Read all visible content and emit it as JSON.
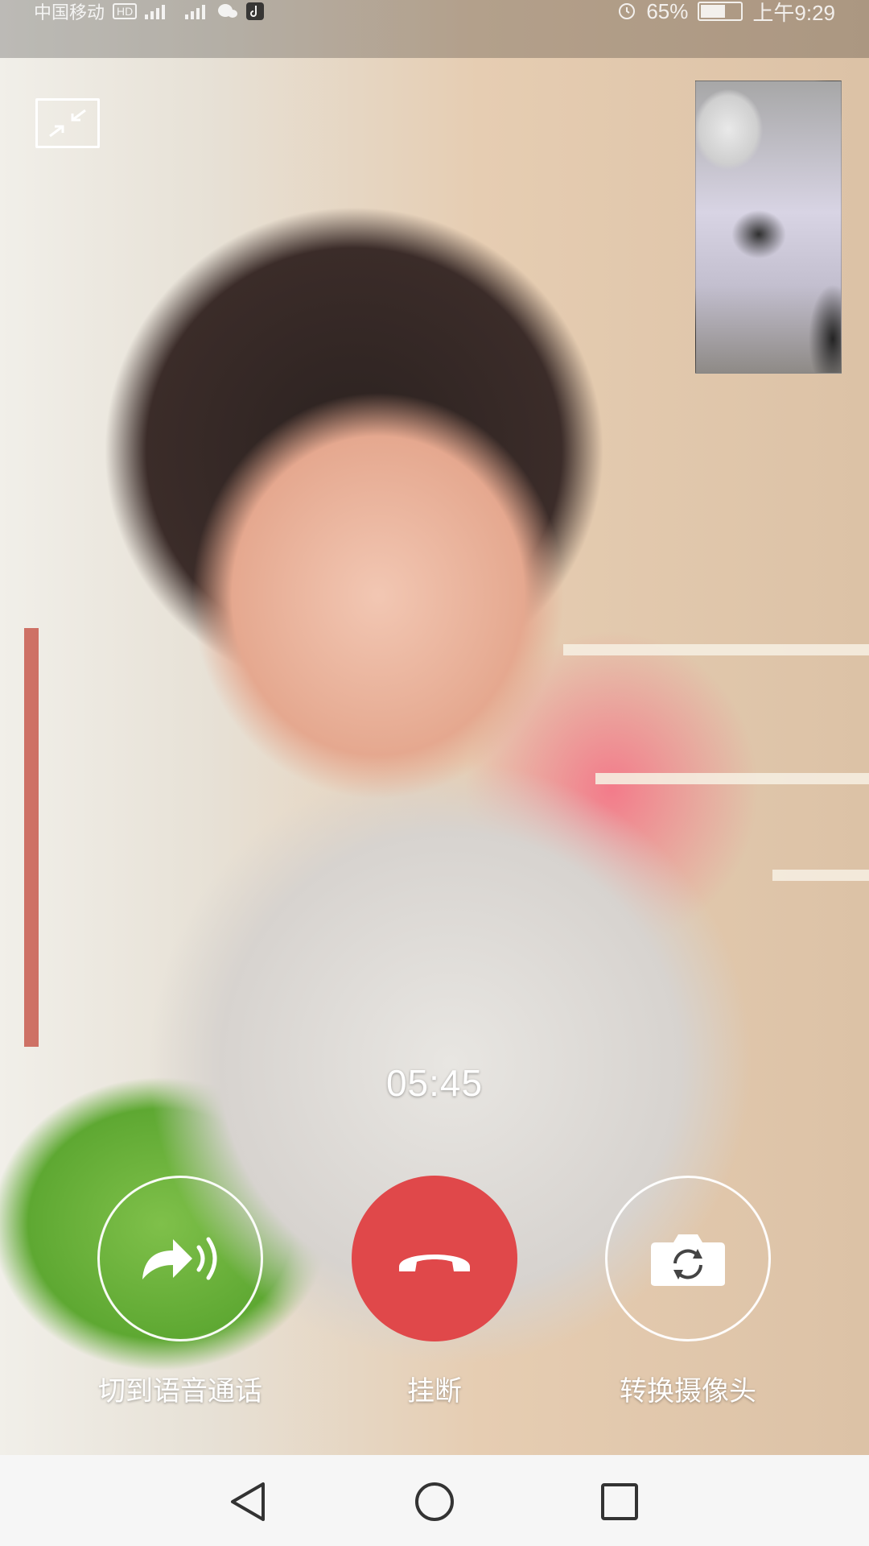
{
  "status_bar": {
    "carrier": "中国移动",
    "hd": "HD",
    "battery": "65%",
    "battery_level": 0.65,
    "time": "上午9:29"
  },
  "call": {
    "timer": "05:45"
  },
  "controls": {
    "switch_voice_label": "切到语音通话",
    "hangup_label": "挂断",
    "switch_camera_label": "转换摄像头"
  },
  "colors": {
    "hangup": "#e0484a",
    "nav_background": "#f6f6f6"
  },
  "icons": {
    "minimize": "shrink-arrows-icon",
    "voice": "voice-forward-icon",
    "hangup": "phone-hangup-icon",
    "camera": "camera-switch-icon",
    "nav_back": "back-triangle-icon",
    "nav_home": "home-circle-icon",
    "nav_recent": "recent-square-icon"
  }
}
